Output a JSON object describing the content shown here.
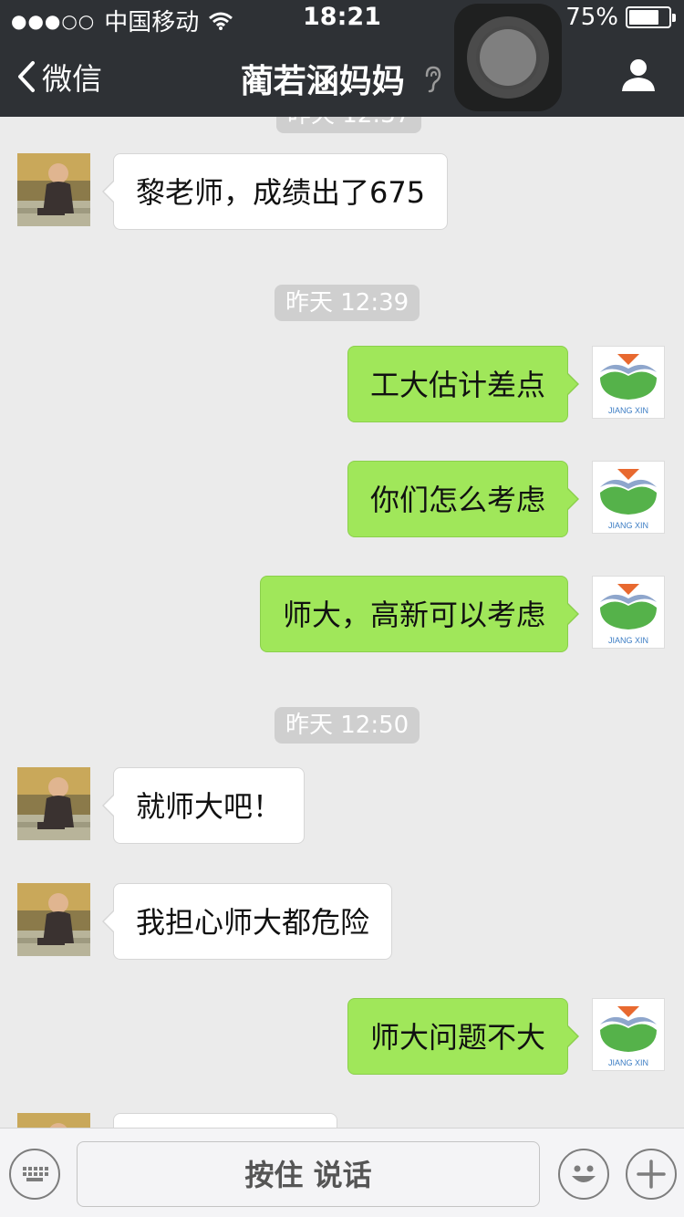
{
  "status_bar": {
    "signal": "●●●○○",
    "carrier": "中国移动",
    "time": "18:21",
    "battery_percent": "75%",
    "battery_level": 0.75
  },
  "nav": {
    "back_label": "微信",
    "title": "蔺若涵妈妈"
  },
  "chat": {
    "timestamps": [
      "昨天 12:39",
      "昨天 12:50"
    ],
    "partial_timestamp": "昨天 12:37",
    "messages": [
      {
        "side": "in",
        "text": "黎老师，成绩出了675"
      },
      {
        "side": "out",
        "text": "工大估计差点"
      },
      {
        "side": "out",
        "text": "你们怎么考虑"
      },
      {
        "side": "out",
        "text": "师大，高新可以考虑"
      },
      {
        "side": "in",
        "text": "就师大吧！"
      },
      {
        "side": "in",
        "text": "我担心师大都危险"
      },
      {
        "side": "out",
        "text": "师大问题不大"
      }
    ]
  },
  "outgoing_avatar_text": "JIANG XIN",
  "input_bar": {
    "hold_to_talk_label": "按住 说话"
  },
  "colors": {
    "nav_bg": "#2e3135",
    "chat_bg": "#ebebeb",
    "outgoing_bubble": "#a0e75a",
    "incoming_bubble": "#ffffff",
    "timestamp_bg": "#cfcfcf"
  }
}
